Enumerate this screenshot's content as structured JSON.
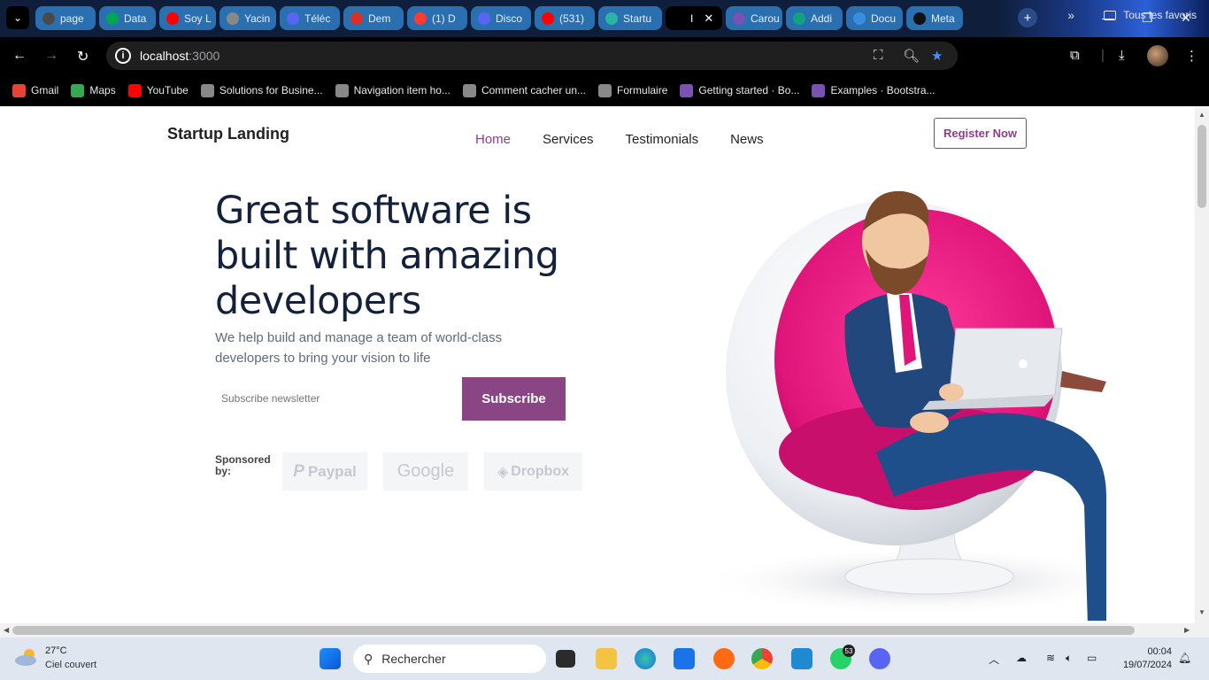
{
  "browser": {
    "tabs": [
      {
        "label": "page",
        "color": "#4a4a4a"
      },
      {
        "label": "Data",
        "color": "#00a64f"
      },
      {
        "label": "Soy L",
        "color": "#ff0000"
      },
      {
        "label": "Yacin",
        "color": "#888888"
      },
      {
        "label": "Téléc",
        "color": "#5865f2"
      },
      {
        "label": "Dem",
        "color": "#d93025"
      },
      {
        "label": "(1) D",
        "color": "#ff3b30"
      },
      {
        "label": "Disco",
        "color": "#5865f2"
      },
      {
        "label": "(531)",
        "color": "#ff0000"
      },
      {
        "label": "Startu",
        "color": "#2bb3a3"
      },
      {
        "label": "I",
        "color": "#000000"
      },
      {
        "label": "Carou",
        "color": "#7952b3"
      },
      {
        "label": "Addi",
        "color": "#10a37f"
      },
      {
        "label": "Docu",
        "color": "#3a8dde"
      },
      {
        "label": "Meta",
        "color": "#111111"
      }
    ],
    "url_host": "localhost",
    "url_port": ":3000",
    "bookmarks": [
      {
        "label": "Gmail",
        "color": "#ea4335"
      },
      {
        "label": "Maps",
        "color": "#34a853"
      },
      {
        "label": "YouTube",
        "color": "#ff0000"
      },
      {
        "label": "Solutions for Busine...",
        "color": "#888888"
      },
      {
        "label": "Navigation item ho...",
        "color": "#888888"
      },
      {
        "label": "Comment cacher un...",
        "color": "#888888"
      },
      {
        "label": "Formulaire",
        "color": "#888888"
      },
      {
        "label": "Getting started · Bo...",
        "color": "#7952b3"
      },
      {
        "label": "Examples · Bootstra...",
        "color": "#7952b3"
      }
    ],
    "all_bookmarks": "Tous les favoris"
  },
  "page": {
    "brand": "Startup Landing",
    "nav": [
      "Home",
      "Services",
      "Testimonials",
      "News"
    ],
    "register": "Register Now",
    "headline": "Great software is built with amazing developers",
    "subtitle": "We help build and manage a team of world-class developers to bring your vision to life",
    "newsletter_placeholder": "Subscribe newsletter",
    "subscribe": "Subscribe",
    "sponsored": "Sponsored by:",
    "sponsors": [
      "Paypal",
      "Google",
      "Dropbox"
    ],
    "accent": "#8a4585"
  },
  "taskbar": {
    "temp": "27°C",
    "weather": "Ciel couvert",
    "search": "Rechercher",
    "time": "00:04",
    "date": "19/07/2024",
    "whatsapp_badge": "53"
  }
}
